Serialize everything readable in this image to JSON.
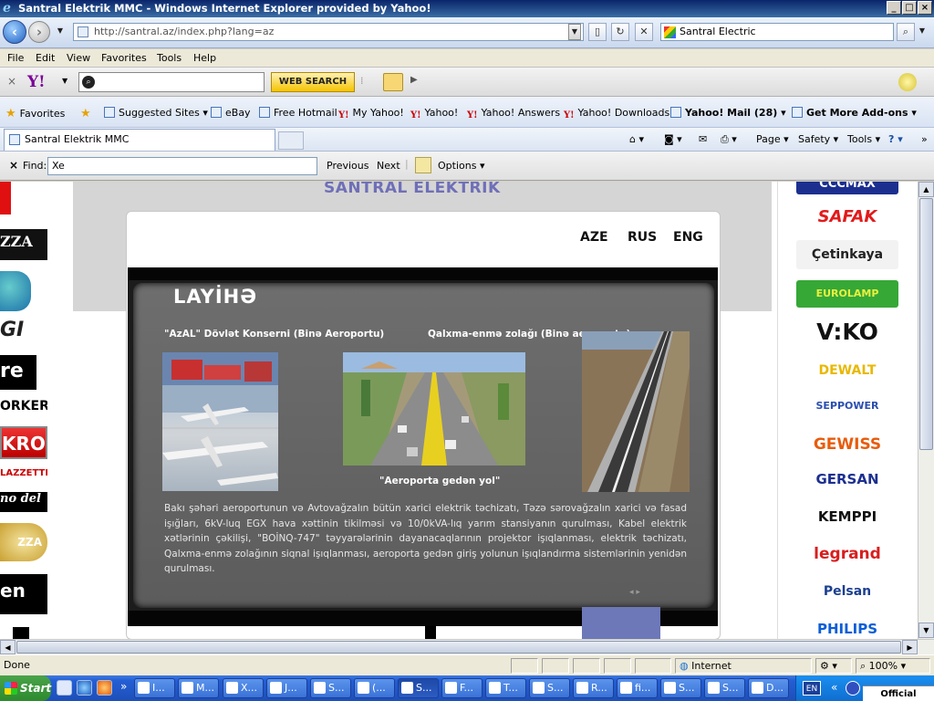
{
  "window": {
    "title": "Santral Elektrik MMC - Windows Internet Explorer provided by Yahoo!"
  },
  "address_bar": {
    "url": "http://santral.az/index.php?lang=az",
    "search_value": "Santral Electric"
  },
  "menu": [
    "File",
    "Edit",
    "View",
    "Favorites",
    "Tools",
    "Help"
  ],
  "yahoo_toolbar": {
    "logo": "Y!",
    "search_value": "",
    "search_button": "WEB SEARCH"
  },
  "favorites_bar": {
    "favorites_label": "Favorites",
    "items": [
      "Suggested Sites",
      "eBay",
      "Free Hotmail",
      "My Yahoo!",
      "Yahoo!",
      "Yahoo! Answers",
      "Yahoo! Downloads",
      "Yahoo! Mail (28)",
      "Get More Add-ons"
    ]
  },
  "tab": {
    "label": "Santral Elektrik MMC"
  },
  "command_bar": {
    "page": "Page",
    "safety": "Safety",
    "tools": "Tools"
  },
  "find_bar": {
    "label": "Find:",
    "value": "Xe",
    "previous": "Previous",
    "next": "Next",
    "options": "Options"
  },
  "page": {
    "site_title": "SANTRAL ELEKTRIK",
    "languages": [
      "AZE",
      "RUS",
      "ENG"
    ],
    "section_title": "LAYİHƏ",
    "caption_left": "\"AzAL\" Dövlət Konserni (Binə Aeroportu)",
    "caption_right": "Qalxma-enmə zolağı (Binə aeroportu)",
    "caption_road": "\"Aeroporta gedən yol\"",
    "body_text": "Bakı şəhəri aeroportunun və Avtovağzalın bütün xarici elektrik təchizatı, Təzə sərovağzalın xarici və fasad işığları, 6kV-luq EGX hava xəttinin tikilməsi və 10/0kVA-lıq yarım stansiyanın qurulması, Kabel elektrik xətlərinin çəkilişi, \"BOİNQ-747\" təyyarələrinin dayanacaqlarının projektor işıqlanması, elektrik təchizatı, Qalxma-enmə zolağının siqnal işıqlanması, aeroporta gedən giriş yolunun işıqlandırma sistemlərinin yenidən qurulması.",
    "left_brands": [
      "ZZA",
      "ORKER",
      "KRO",
      "LAZZETTI",
      "no del",
      "ZZA",
      "en"
    ],
    "right_brands": [
      {
        "name": "CCCMAX",
        "color": "#1c2f8f"
      },
      {
        "name": "SAFAK",
        "color": "#e21b1b"
      },
      {
        "name": "Çetinkaya",
        "color": "#222222"
      },
      {
        "name": "EUROLAMP",
        "color": "#2a9a2a"
      },
      {
        "name": "V:KO",
        "color": "#111111"
      },
      {
        "name": "DEWALT",
        "color": "#e8b800"
      },
      {
        "name": "SEPPOWER",
        "color": "#2a4fb0"
      },
      {
        "name": "GEWISS",
        "color": "#e85c0c"
      },
      {
        "name": "GERSAN",
        "color": "#1c2f8f"
      },
      {
        "name": "KEMPPI",
        "color": "#c4161c"
      },
      {
        "name": "legrand",
        "color": "#d91e1e"
      },
      {
        "name": "Pelsan",
        "color": "#1c3f8f"
      },
      {
        "name": "PHILIPS",
        "color": "#0b5ed7"
      }
    ]
  },
  "status_bar": {
    "status": "Done",
    "zone": "Internet",
    "zoom": "100%"
  },
  "taskbar": {
    "start": "Start",
    "buttons": [
      "I...",
      "M...",
      "X...",
      "J...",
      "S...",
      "(...",
      "S...",
      "F...",
      "T...",
      "S...",
      "R...",
      "fi...",
      "S...",
      "S...",
      "D..."
    ],
    "language": "EN"
  },
  "watermark": "Official website"
}
